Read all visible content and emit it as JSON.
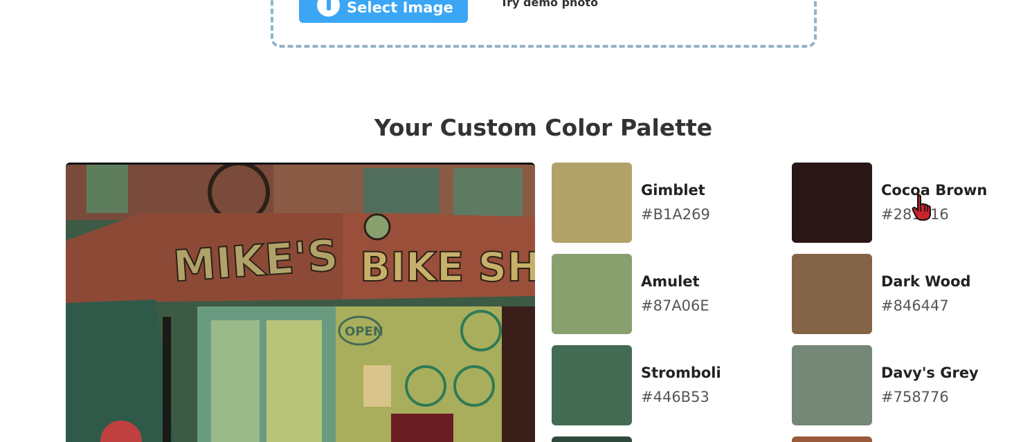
{
  "upload": {
    "select_label": "Select Image",
    "demo_label": "Try demo photo"
  },
  "palette_title": "Your Custom Color Palette",
  "photo": {
    "sign_left": "MIKE'S",
    "sign_right": "BIKE SHO",
    "window_sign": "OPEN"
  },
  "colors": {
    "left": [
      {
        "name": "Gimblet",
        "hex": "#B1A269",
        "color": "#B1A269"
      },
      {
        "name": "Amulet",
        "hex": "#87A06E",
        "color": "#87A06E"
      },
      {
        "name": "Stromboli",
        "hex": "#446B53",
        "color": "#446B53"
      }
    ],
    "right": [
      {
        "name": "Cocoa Brown",
        "hex": "#281716",
        "color": "#281716"
      },
      {
        "name": "Dark Wood",
        "hex": "#846447",
        "color": "#846447"
      },
      {
        "name": "Davy's Grey",
        "hex": "#758776",
        "color": "#758776"
      }
    ],
    "partial_left_color": "#2f4a3c",
    "partial_right_color": "#9a5a3c"
  },
  "cursor_icon": "hand-pointer-icon"
}
